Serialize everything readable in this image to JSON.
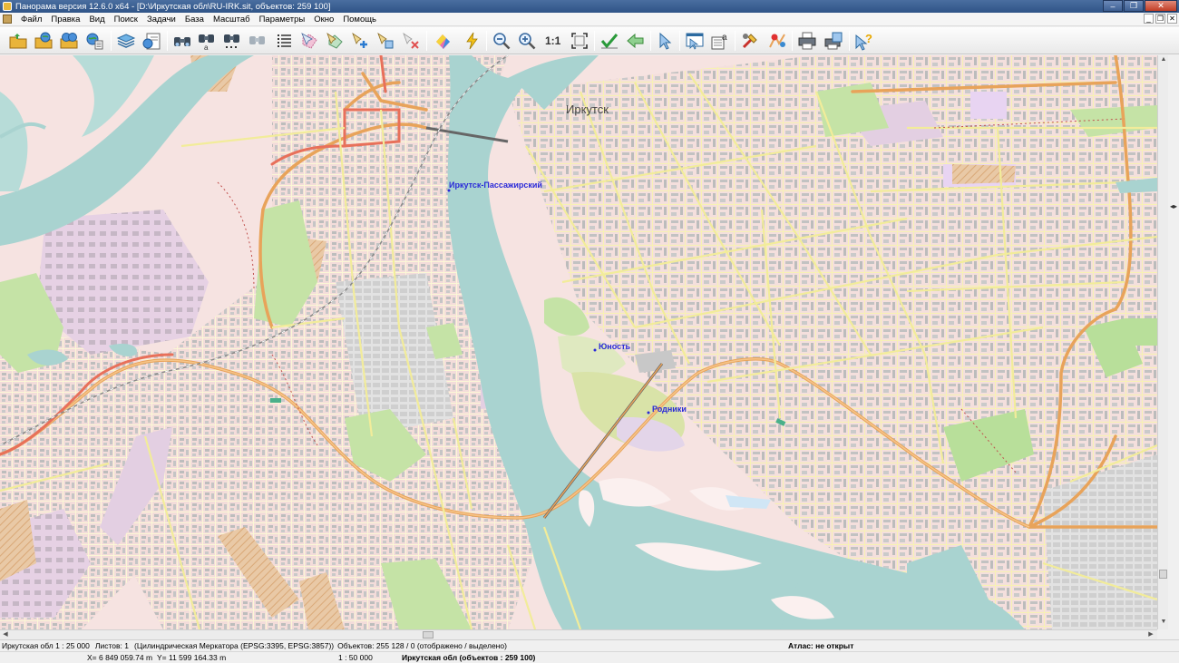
{
  "window": {
    "title": "Панорама версия 12.6.0 x64 - [D:\\Иркутская обл\\RU-IRK.sit, объектов: 259 100]",
    "minimize": "–",
    "maximize": "❐",
    "close": "✕"
  },
  "menu": {
    "items": [
      "Файл",
      "Правка",
      "Вид",
      "Поиск",
      "Задачи",
      "База",
      "Масштаб",
      "Параметры",
      "Окно",
      "Помощь"
    ]
  },
  "toolbar": {
    "scale_1_1_label": "1:1",
    "icons": [
      "open-folder-icon",
      "open-map-icon",
      "open-atlas-icon",
      "map-list-icon",
      "layers-icon",
      "legend-icon",
      "binoculars-icon",
      "binoculars-text-icon",
      "binoculars-area-icon",
      "binoculars-disabled-icon",
      "list-icon",
      "select-object-icon",
      "edit-object-icon",
      "add-object-icon",
      "object-info-icon",
      "delete-object-icon",
      "palette-icon",
      "lightning-icon",
      "zoom-out-icon",
      "zoom-in-icon",
      "scale-1-1-icon",
      "fit-frame-icon",
      "check-icon",
      "back-arrow-icon",
      "pointer-icon",
      "map-window-icon",
      "text-properties-icon",
      "tools-icon",
      "route-icon",
      "print-icon",
      "print-preview-icon",
      "help-pointer-icon"
    ]
  },
  "map": {
    "labels": {
      "city": "Иркутск",
      "station": "Иркутск-Пассажирский",
      "yunost": "Юность",
      "rodniki": "Родники"
    },
    "colors": {
      "land": "#f6e3e1",
      "water": "#a9d3d0",
      "river_light": "#b7dcd8",
      "road_major": "#e8a35a",
      "road_secondary": "#f2ec9a",
      "green": "#c5e3a6",
      "industrial": "#e3cfe2",
      "building": "#bdbdbd"
    }
  },
  "status": {
    "scale_info": "Иркутская обл   1 : 25 000",
    "sheets": "Листов: 1",
    "projection": "(Цилиндрическая Меркатора (EPSG:3395, EPSG:3857))",
    "objects": "Объектов: 255 128 / 0 (отображено / выделено)",
    "atlas": "Атлас: не открыт",
    "x_coord": "X= 6 849 059.74 m",
    "y_coord": "Y= 11 599 164.33 m",
    "map_scale": "1 : 50 000",
    "map_objects": "Иркутская обл   (объектов : 259 100)"
  }
}
